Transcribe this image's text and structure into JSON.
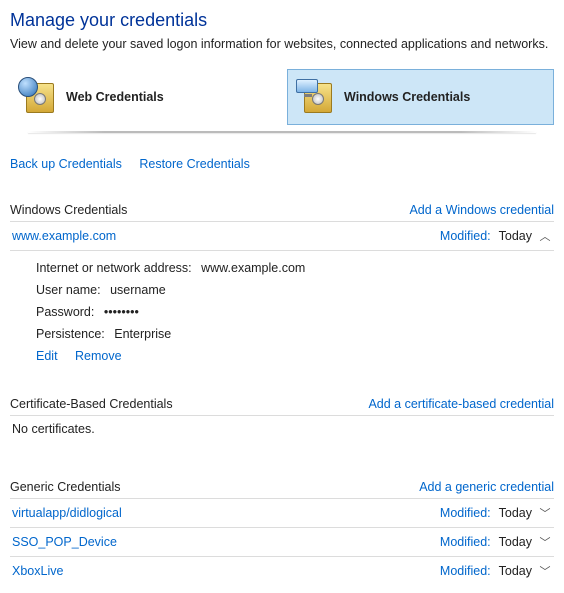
{
  "header": {
    "title": "Manage your credentials",
    "subtitle": "View and delete your saved logon information for websites, connected applications and networks."
  },
  "tabs": {
    "web": "Web Credentials",
    "windows": "Windows Credentials"
  },
  "actions": {
    "backup": "Back up Credentials",
    "restore": "Restore Credentials"
  },
  "windows_creds": {
    "title": "Windows Credentials",
    "add": "Add a Windows credential",
    "item": {
      "name": "www.example.com",
      "modified_label": "Modified:",
      "modified_value": "Today",
      "details": {
        "address_label": "Internet or network address:",
        "address_value": "www.example.com",
        "user_label": "User name:",
        "user_value": "username",
        "password_label": "Password:",
        "password_value": "••••••••",
        "persist_label": "Persistence:",
        "persist_value": "Enterprise"
      },
      "edit": "Edit",
      "remove": "Remove"
    }
  },
  "cert_creds": {
    "title": "Certificate-Based Credentials",
    "add": "Add a certificate-based credential",
    "empty": "No certificates."
  },
  "generic_creds": {
    "title": "Generic Credentials",
    "add": "Add a generic credential",
    "modified_label": "Modified:",
    "items": [
      {
        "name": "virtualapp/didlogical",
        "modified": "Today"
      },
      {
        "name": "SSO_POP_Device",
        "modified": "Today"
      },
      {
        "name": "XboxLive",
        "modified": "Today"
      }
    ]
  }
}
